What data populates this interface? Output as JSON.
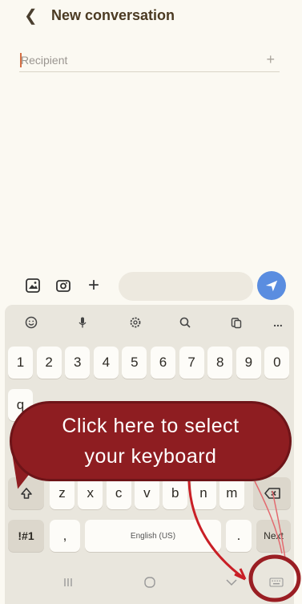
{
  "header": {
    "back_icon": "chevron-left-icon",
    "title": "New conversation"
  },
  "recipient": {
    "placeholder": "Recipient",
    "value": "",
    "add_icon": "plus-icon"
  },
  "compose": {
    "icons": [
      "gallery-icon",
      "camera-icon",
      "plus-icon"
    ],
    "send_icon": "send-icon",
    "send_color": "#5a8de0"
  },
  "keyboard": {
    "toolbar_icons": [
      "emoji-icon",
      "microphone-icon",
      "settings-icon",
      "search-icon",
      "clipboard-icon",
      "more-icon"
    ],
    "number_row": [
      "1",
      "2",
      "3",
      "4",
      "5",
      "6",
      "7",
      "8",
      "9",
      "0"
    ],
    "letter_row_2": [
      "z",
      "x",
      "c",
      "v",
      "b",
      "n",
      "m"
    ],
    "bottom_row": {
      "symbols": "!#1",
      "comma": ",",
      "space": "English (US)",
      "period": ".",
      "next": "Next"
    },
    "more_label": "..."
  },
  "navbar": {
    "icons": [
      "recent-apps-icon",
      "home-icon",
      "back-down-icon",
      "keyboard-select-icon"
    ]
  },
  "annotation": {
    "line1": "Click here to select",
    "line2": "your keyboard",
    "callout_color": "#8e1d21",
    "arrow_color": "#c91f26"
  }
}
